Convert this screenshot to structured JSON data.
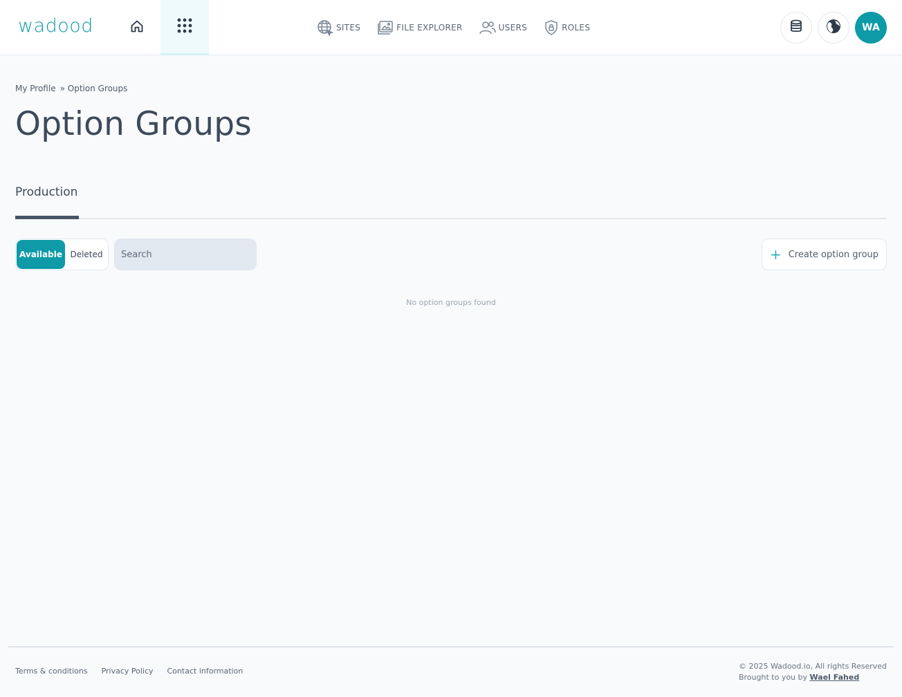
{
  "header": {
    "logo": "wadood",
    "nav": [
      {
        "label": "SITES",
        "icon": "globe-icon"
      },
      {
        "label": "FILE EXPLORER",
        "icon": "folder-image-icon"
      },
      {
        "label": "USERS",
        "icon": "users-icon"
      },
      {
        "label": "ROLES",
        "icon": "shield-lock-icon"
      }
    ],
    "avatar_initials": "WA",
    "accent": "#0e9aa7"
  },
  "breadcrumb": {
    "items": [
      "My Profile",
      "» Option Groups"
    ]
  },
  "page": {
    "title": "Option Groups"
  },
  "tabs": [
    {
      "label": "Production",
      "active": true
    }
  ],
  "filters": {
    "available_label": "Available",
    "deleted_label": "Deleted",
    "search_placeholder": "Search"
  },
  "actions": {
    "create_label": "Create option group"
  },
  "empty_state": "No option groups found",
  "footer": {
    "links": [
      "Terms & conditions",
      "Privacy Policy",
      "Contact information"
    ],
    "copyright": "© 2025 Wadood.io, All rights Reserved",
    "brought_prefix": "Brought to you by",
    "author": "Wael Fahed"
  }
}
